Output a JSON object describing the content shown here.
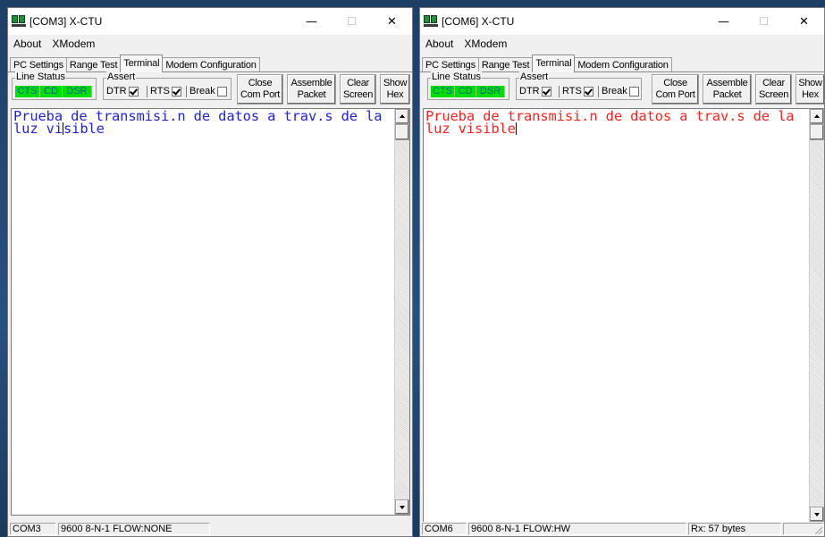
{
  "colors": {
    "led_green": "#00e000",
    "led_text": "#005a9e",
    "terminal_left_text": "#1f1fe0",
    "terminal_right_text": "#ff2020"
  },
  "windows": {
    "left": {
      "title": "[COM3] X-CTU",
      "menu": {
        "about": "About",
        "xmodem": "XModem"
      },
      "tabs": {
        "pc_settings": "PC Settings",
        "range_test": "Range Test",
        "terminal": "Terminal",
        "modem_configuration": "Modem Configuration"
      },
      "line_status": {
        "label": "Line Status",
        "cts": "CTS",
        "cd": "CD",
        "dsr": "DSR"
      },
      "assert": {
        "label": "Assert",
        "dtr": "DTR",
        "dtr_checked": true,
        "rts": "RTS",
        "rts_checked": true,
        "break": "Break",
        "break_checked": false
      },
      "buttons": {
        "close_com_port": {
          "line1": "Close",
          "line2": "Com Port"
        },
        "assemble_packet": {
          "line1": "Assemble",
          "line2": "Packet"
        },
        "clear_screen": {
          "line1": "Clear",
          "line2": "Screen"
        },
        "show_hex": {
          "line1": "Show",
          "line2": "Hex"
        }
      },
      "terminal": {
        "text_before_cursor": "Prueba de transmisi.n de datos a trav.s de la luz vi",
        "text_after_cursor": "sible"
      },
      "status": {
        "port": "COM3",
        "settings": "9600 8-N-1  FLOW:NONE"
      }
    },
    "right": {
      "title": "[COM6] X-CTU",
      "menu": {
        "about": "About",
        "xmodem": "XModem"
      },
      "tabs": {
        "pc_settings": "PC Settings",
        "range_test": "Range Test",
        "terminal": "Terminal",
        "modem_configuration": "Modem Configuration"
      },
      "line_status": {
        "label": "Line Status",
        "cts": "CTS",
        "cd": "CD",
        "dsr": "DSR"
      },
      "assert": {
        "label": "Assert",
        "dtr": "DTR",
        "dtr_checked": true,
        "rts": "RTS",
        "rts_checked": true,
        "break": "Break",
        "break_checked": false
      },
      "buttons": {
        "close_com_port": {
          "line1": "Close",
          "line2": "Com Port"
        },
        "assemble_packet": {
          "line1": "Assemble",
          "line2": "Packet"
        },
        "clear_screen": {
          "line1": "Clear",
          "line2": "Screen"
        },
        "show_hex": {
          "line1": "Show",
          "line2": "Hex"
        }
      },
      "terminal": {
        "text_before_cursor": "Prueba de transmisi.n de datos a trav.s de la luz visible",
        "text_after_cursor": ""
      },
      "status": {
        "port": "COM6",
        "settings": "9600 8-N-1  FLOW:HW",
        "rx": "Rx: 57 bytes"
      }
    }
  }
}
